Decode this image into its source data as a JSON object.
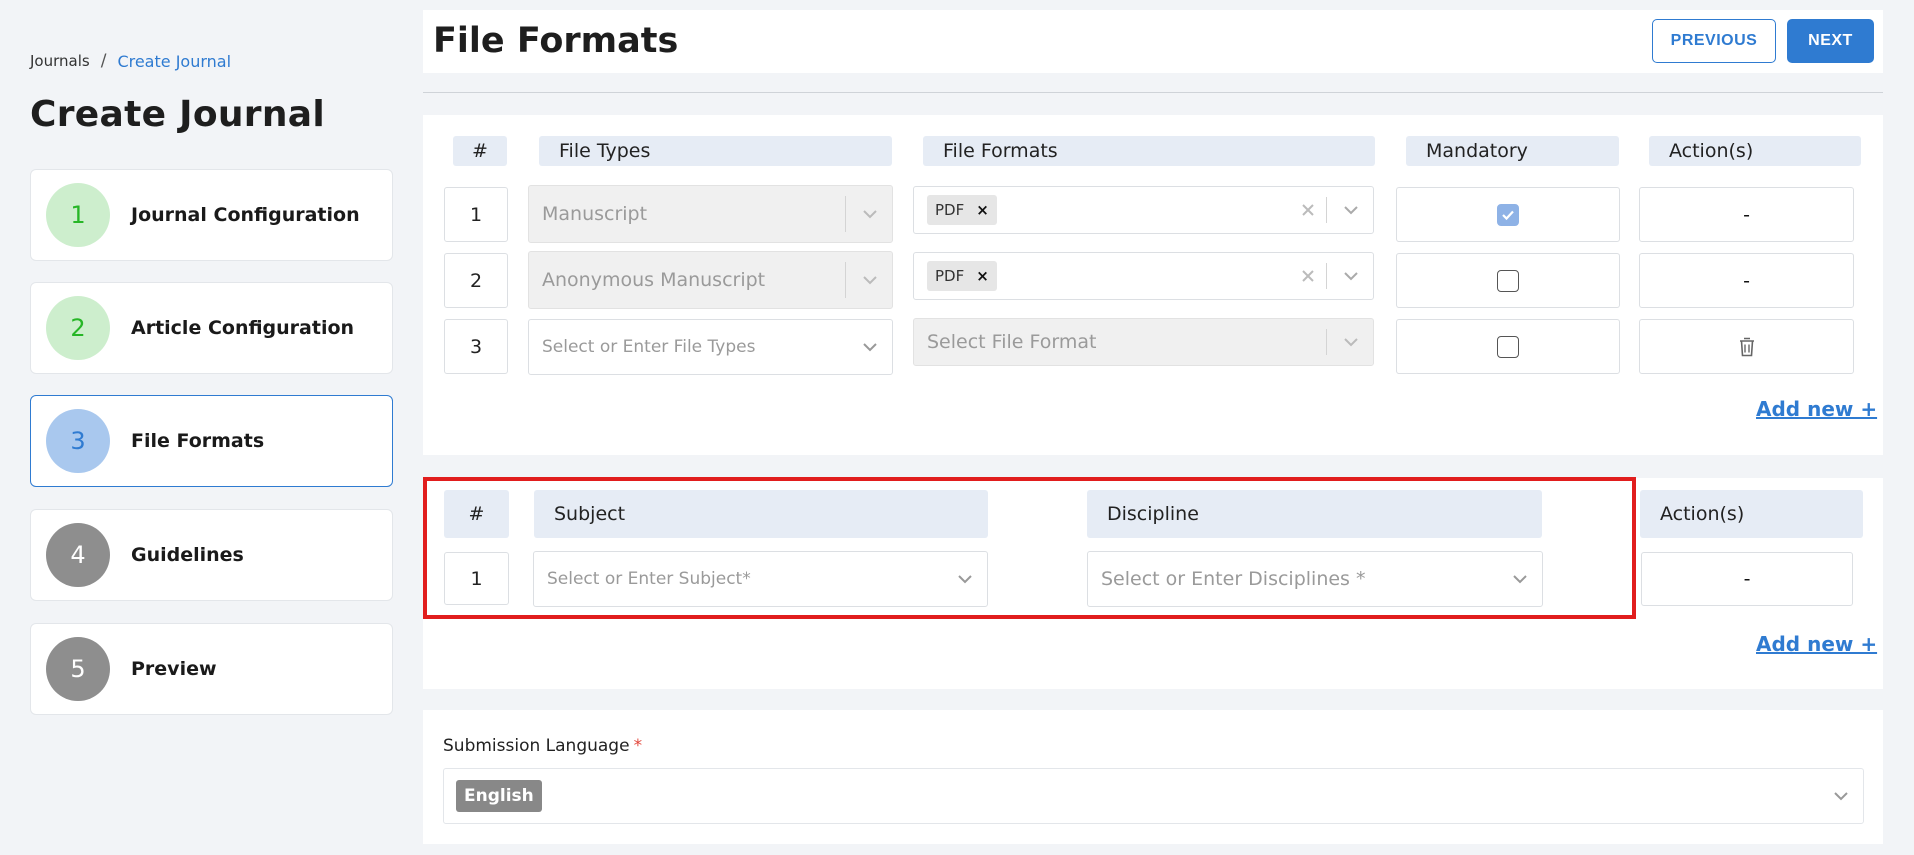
{
  "breadcrumb": {
    "root": "Journals",
    "separator": "/",
    "current": "Create Journal"
  },
  "page_title": "Create Journal",
  "steps": [
    {
      "number": "1",
      "label": "Journal Configuration",
      "state": "done"
    },
    {
      "number": "2",
      "label": "Article Configuration",
      "state": "done"
    },
    {
      "number": "3",
      "label": "File Formats",
      "state": "current"
    },
    {
      "number": "4",
      "label": "Guidelines",
      "state": "pending"
    },
    {
      "number": "5",
      "label": "Preview",
      "state": "pending"
    }
  ],
  "header": {
    "title": "File Formats",
    "previous_label": "PREVIOUS",
    "next_label": "NEXT"
  },
  "file_table": {
    "headers": {
      "num": "#",
      "file_types": "File Types",
      "file_formats": "File Formats",
      "mandatory": "Mandatory",
      "actions": "Action(s)"
    },
    "rows": [
      {
        "num": "1",
        "file_type": "Manuscript",
        "format_tag": "PDF",
        "tag_remove": "×",
        "mandatory": true,
        "action": "-"
      },
      {
        "num": "2",
        "file_type": "Anonymous Manuscript",
        "format_tag": "PDF",
        "tag_remove": "×",
        "mandatory": false,
        "action": "-"
      },
      {
        "num": "3",
        "file_type_placeholder": "Select or Enter File Types",
        "format_placeholder": "Select File Format",
        "mandatory": false,
        "action_icon": "trash-icon"
      }
    ],
    "add_new": "Add new +"
  },
  "subject_table": {
    "headers": {
      "num": "#",
      "subject": "Subject",
      "discipline": "Discipline",
      "actions": "Action(s)"
    },
    "rows": [
      {
        "num": "1",
        "subject_placeholder": "Select or Enter Subject*",
        "discipline_placeholder": "Select or Enter Disciplines *",
        "action": "-"
      }
    ],
    "add_new": "Add new +"
  },
  "submission_language": {
    "label": "Submission Language",
    "required_mark": "*",
    "selected": "English"
  },
  "colors": {
    "accent": "#2f7bd1",
    "highlight": "#e11d1d",
    "done": "#27b627",
    "pending": "#8e8e8e"
  }
}
